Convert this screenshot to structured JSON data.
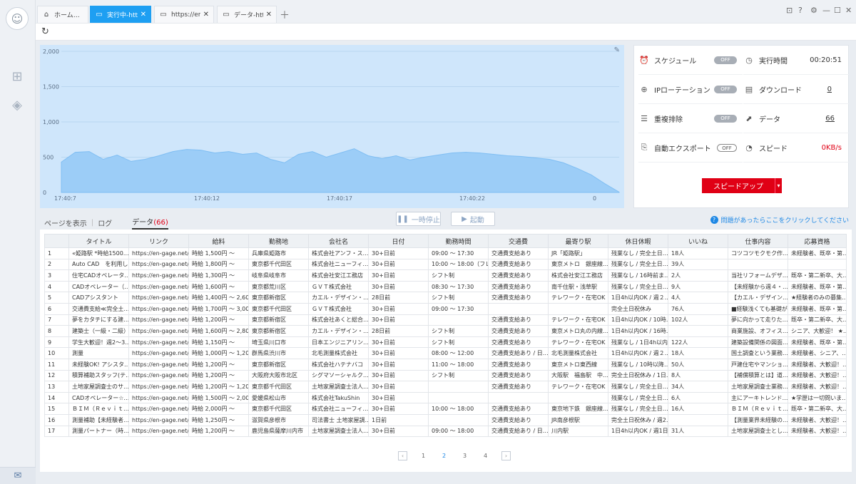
{
  "tabs": [
    {
      "label": "ホーム…",
      "icon": "home-icon",
      "active": false
    },
    {
      "label": "実行中-htt…",
      "icon": "page-icon",
      "active": true
    },
    {
      "label": "https://en-…",
      "icon": "page-icon",
      "active": false
    },
    {
      "label": "データ-htt…",
      "icon": "page-icon",
      "active": false
    }
  ],
  "chart_data": {
    "type": "area",
    "x_ticks": [
      "17:40:7",
      "17:40:12",
      "17:40:17",
      "17:40:22",
      "0"
    ],
    "yticks": [
      0,
      500,
      1000,
      1500,
      2000
    ],
    "ytick_labels": [
      "0",
      "500",
      "1,000",
      "1,500",
      "2,000"
    ],
    "ylim": [
      0,
      2000
    ],
    "x": [
      0,
      1,
      2,
      3,
      4,
      5,
      6,
      7,
      8,
      9,
      10,
      11,
      12,
      13,
      14,
      15,
      16,
      17,
      18,
      19,
      20,
      21,
      22,
      23,
      24,
      25,
      26,
      27,
      28,
      29,
      30,
      31,
      32,
      33,
      34,
      35,
      36,
      37,
      38,
      39,
      40
    ],
    "values": [
      430,
      570,
      580,
      470,
      530,
      440,
      470,
      520,
      580,
      610,
      600,
      560,
      580,
      540,
      560,
      470,
      420,
      540,
      580,
      500,
      560,
      620,
      520,
      480,
      520,
      460,
      500,
      530,
      560,
      570,
      560,
      540,
      520,
      510,
      490,
      470,
      420,
      340,
      250,
      120,
      5
    ],
    "grid": true,
    "color": "#9ccdf7"
  },
  "status": {
    "schedule_label": "スケジュール",
    "schedule_state": "OFF",
    "runtime_label": "実行時間",
    "runtime_value": "00:20:51",
    "ip_label": "IPローテーション",
    "ip_state": "OFF",
    "download_label": "ダウンロード",
    "download_value": "0",
    "dedup_label": "重複排除",
    "dedup_state": "OFF",
    "data_label": "データ",
    "data_value": "66",
    "autoexport_label": "自動エクスポート",
    "autoexport_state": "OFF",
    "speed_label": "スピード",
    "speed_value": "0KB/s"
  },
  "speedup_label": "スピードアップ",
  "view": {
    "page": "ページを表示",
    "log": "ログ",
    "data": "データ",
    "data_count": "(66)"
  },
  "pause_label": "一時停止",
  "start_label": "起動",
  "help_text": "問題があったらここをクリックしてください",
  "table": {
    "headers": [
      "",
      "タイトル",
      "リンク",
      "給料",
      "勤務地",
      "会社名",
      "日付",
      "勤務時間",
      "交通費",
      "最寄り駅",
      "休日休暇",
      "いいね",
      "仕事内容",
      "応募資格"
    ],
    "rows": [
      [
        "1",
        "«姫路駅 *時給1500…",
        "https://en-gage.net/u…",
        "時給 1,500円 ～",
        "兵庫県姫路市",
        "株式会社アンフ・ス…",
        "30+日前",
        "09:00 ～ 17:30",
        "交通費支給あり",
        "JR「姫路駅」",
        "残業なし / 完全土日…",
        "18人",
        "コツコツモクモク作…",
        "未経験者、既卒・第…"
      ],
      [
        "2",
        "Auto CAD　を利用し…",
        "https://en-gage.net/u…",
        "時給 1,800円 ～",
        "東京都千代田区",
        "株式会社ニューフィ…",
        "30+日前",
        "10:00 ～ 18:00（フレ…",
        "交通費支給あり",
        "東京メトロ　銀座線…",
        "残業なし / 完全土日…",
        "39人",
        "",
        ""
      ],
      [
        "3",
        "住宅CADオペレータ…",
        "https://en-gage.net/u…",
        "時給 1,300円 ～",
        "岐阜県岐阜市",
        "株式会社安江工務店",
        "30+日前",
        "シフト制",
        "交通費支給あり",
        "株式会社安江工務店",
        "残業なし / 16時前ま…",
        "2人",
        "当社リフォームデザ…",
        "既卒・第二新卒、大…"
      ],
      [
        "4",
        "CADオペレーター（…",
        "https://en-gage.net/u…",
        "時給 1,600円 ～",
        "東京都荒川区",
        "ＧＶＴ株式会社",
        "30+日前",
        "08:30 ～ 17:30",
        "交通費支給あり",
        "南千住駅・浅草駅",
        "残業なし / 完全土日…",
        "9人",
        "【未経験から週４・…",
        "未経験者、既卒・第…"
      ],
      [
        "5",
        "CADアシスタント",
        "https://en-gage.net/u…",
        "時給 1,400円 ～ 2,60…",
        "東京都新宿区",
        "カエル・デザイン・…",
        "28日前",
        "シフト制",
        "交通費支給あり",
        "テレワーク・在宅OK",
        "1日4h以内OK / 週２…",
        "4人",
        "【カエル・デザイン…",
        "★経験者のみの募集…"
      ],
      [
        "6",
        "交通費支給≪完全土…",
        "https://en-gage.net/u…",
        "時給 1,700円 ～ 3,00…",
        "東京都千代田区",
        "ＧＶＴ株式会社",
        "30+日前",
        "09:00 ～ 17:30",
        "",
        "",
        "完全土日祝休み",
        "76人",
        "■経験浅くても基礎が…",
        "未経験者、既卒・第…"
      ],
      [
        "7",
        "夢をカタチにする建…",
        "https://en-gage.net/u…",
        "時給 1,200円 ～",
        "東京都新宿区",
        "株式会社あくと総合…",
        "30+日前",
        "",
        "交通費支給あり",
        "テレワーク・在宅OK",
        "1日4h以内OK / 10時…",
        "102人",
        "夢に向かって走りた…",
        "既卒・第二新卒、大…"
      ],
      [
        "8",
        "建築士（一級・二級）",
        "https://en-gage.net/u…",
        "時給 1,600円 ～ 2,80…",
        "東京都新宿区",
        "カエル・デザイン・…",
        "28日前",
        "シフト制",
        "交通費支給あり",
        "東京メトロ丸の内線…",
        "1日4h以内OK / 16時…",
        "",
        "商業施設、オフィス…",
        "シニア、大歓迎！ ★…"
      ],
      [
        "9",
        "学生大歓迎！週2～3…",
        "https://en-gage.net/u…",
        "時給 1,150円 ～",
        "埼玉県川口市",
        "日本エンジニアリン…",
        "30+日前",
        "シフト制",
        "交通費支給あり",
        "テレワーク・在宅OK",
        "残業なし / 1日4h以内…",
        "122人",
        "建築設備関係の図面…",
        "未経験者、既卒・第…"
      ],
      [
        "10",
        "測量",
        "https://en-gage.net/u…",
        "時給 1,000円 ～ 1,20…",
        "群馬県渋川市",
        "北毛測量株式会社",
        "30+日前",
        "08:00 ～ 12:00",
        "交通費支給あり / 日…",
        "北毛測量株式会社",
        "1日4h以内OK / 週２…",
        "18人",
        "国土調査という業務…",
        "未経験者、シニア、…"
      ],
      [
        "11",
        "未経験OK! アシスタ…",
        "https://en-gage.net/u…",
        "時給 1,200円 ～",
        "東京都新宿区",
        "株式会社ハテナバコ",
        "30+日前",
        "11:00 ～ 18:00",
        "交通費支給あり",
        "東京メトロ東西線",
        "残業なし / 10時以降…",
        "50人",
        "戸建住宅やマンショ…",
        "未経験者、大歓迎！…"
      ],
      [
        "12",
        "積算補助スタッフ(テ…",
        "https://en-gage.net/u…",
        "時給 1,200円 ～",
        "大阪府大阪市北区",
        "シグマソーシャルク…",
        "30+日前",
        "シフト制",
        "交通費支給あり",
        "大阪駅　福島駅　中…",
        "完全土日祝休み / 1日…",
        "8人",
        "【補償積算とは】道…",
        "未経験者、大歓迎！…"
      ],
      [
        "13",
        "土地家屋調査士のサ…",
        "https://en-gage.net/u…",
        "時給 1,200円 ～ 1,20…",
        "東京都千代田区",
        "土地家屋調査士法人…",
        "30+日前",
        "",
        "交通費支給あり",
        "テレワーク・在宅OK",
        "残業なし / 完全土日…",
        "34人",
        "土地家屋調査士業務…",
        "未経験者、大歓迎！…"
      ],
      [
        "14",
        "CADオペレーター☆…",
        "https://en-gage.net/u…",
        "時給 1,500円 ～ 2,00…",
        "愛媛県松山市",
        "株式会社TakuShin",
        "30+日前",
        "",
        "",
        "",
        "残業なし / 完全土日…",
        "6人",
        "主にアーキトレンド…",
        "★学歴は一切問いま…"
      ],
      [
        "15",
        "ＢＩＭ（Ｒｅｖｉｔ…",
        "https://en-gage.net/u…",
        "時給 2,000円 ～",
        "東京都千代田区",
        "株式会社ニューフィ…",
        "30+日前",
        "10:00 ～ 18:00",
        "交通費支給あり",
        "東京地下鉄　銀座線…",
        "残業なし / 完全土日…",
        "16人",
        "ＢＩＭ（Ｒｅｖｉｔ…",
        "既卒・第二新卒、大…"
      ],
      [
        "16",
        "測量補助【未経験者…",
        "https://en-gage.net/u…",
        "時給 1,250円 ～",
        "滋賀県彦根市",
        "司法書士 土地家屋調…",
        "1日前",
        "",
        "交通費支給あり",
        "JR南彦根駅",
        "完全土日祝休み / 週2…",
        "",
        "【測量業界未経験の…",
        "未経験者、大歓迎！…"
      ],
      [
        "17",
        "測量パートナー（時…",
        "https://en-gage.net/u…",
        "時給 1,200円 ～",
        "鹿児島県薩摩川内市",
        "土地家屋調査士法人…",
        "30+日前",
        "09:00 ～ 18:00",
        "交通費支給あり / 日…",
        "川内駅",
        "1日4h以内OK / 週1日…",
        "31人",
        "土地家屋調査士とし…",
        "未経験者、大歓迎！…"
      ]
    ]
  },
  "pagination": [
    "1",
    "2",
    "3",
    "4"
  ],
  "current_page": "2"
}
